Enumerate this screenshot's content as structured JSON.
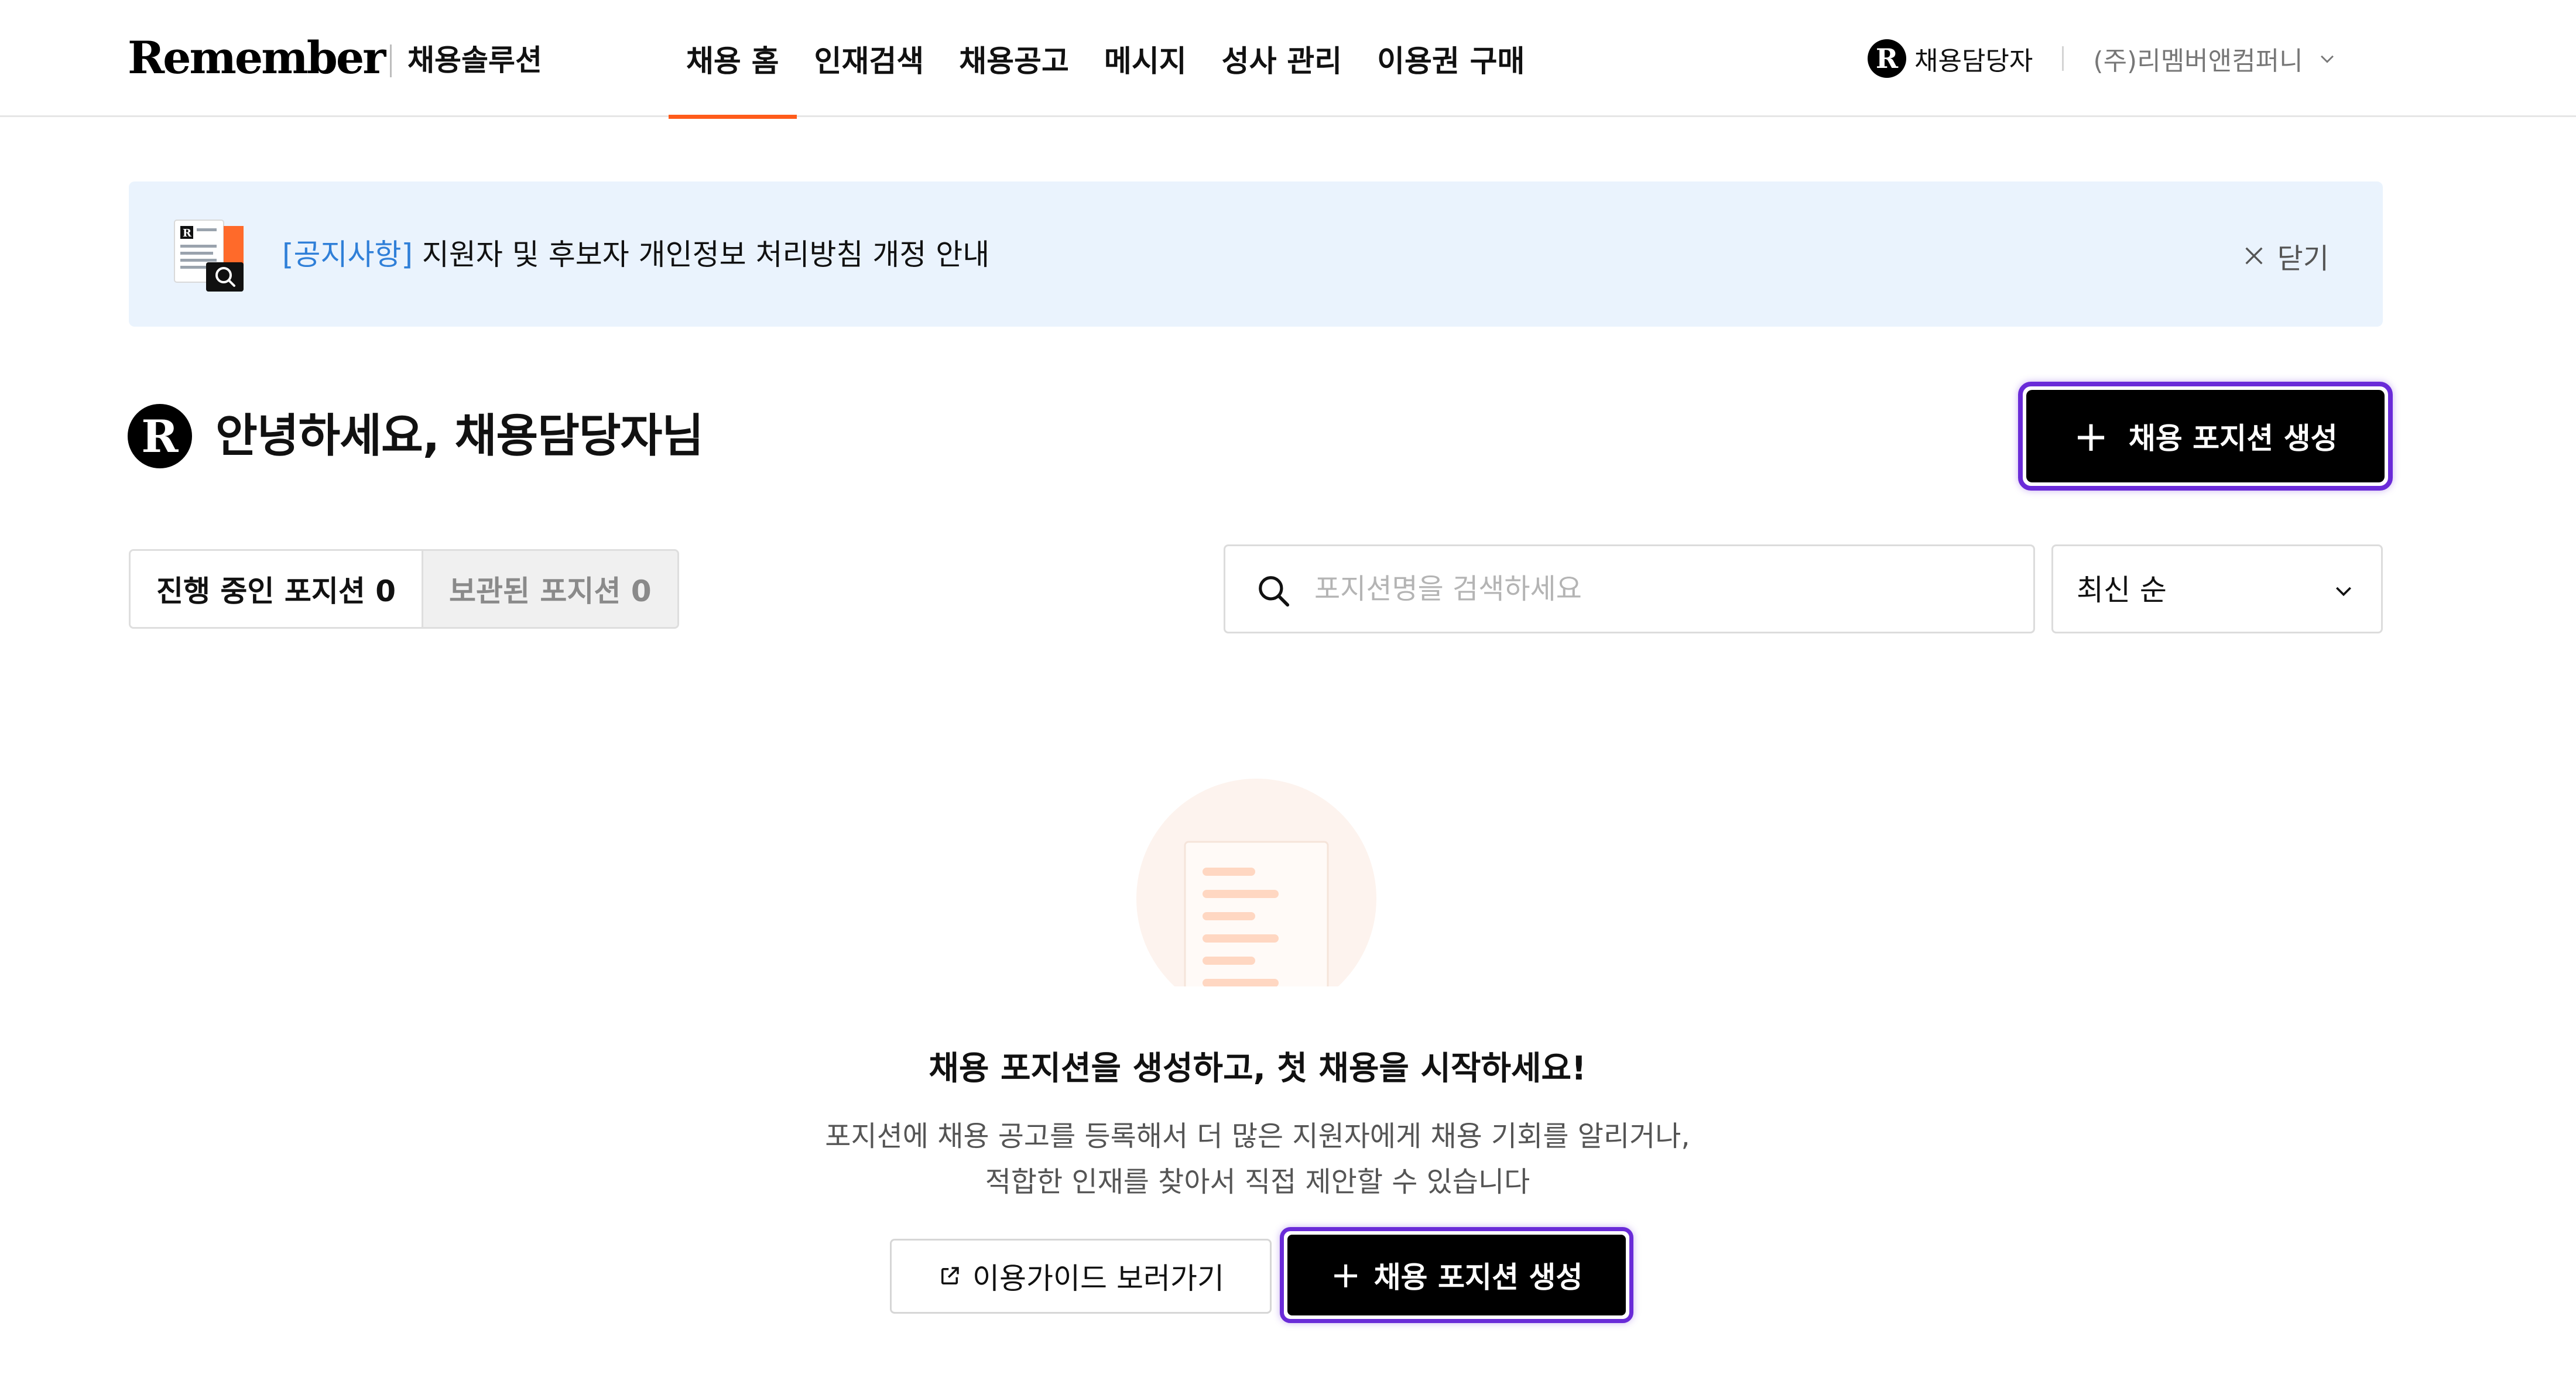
{
  "header": {
    "logo": "Remember",
    "logo_sub": "채용솔루션",
    "nav": [
      {
        "label": "채용 홈",
        "active": true
      },
      {
        "label": "인재검색",
        "active": false
      },
      {
        "label": "채용공고",
        "active": false
      },
      {
        "label": "메시지",
        "active": false
      },
      {
        "label": "성사 관리",
        "active": false
      },
      {
        "label": "이용권 구매",
        "active": false
      }
    ],
    "user_badge": "R",
    "user_name": "채용담당자",
    "company": "(주)리멤버앤컴퍼니"
  },
  "notice": {
    "tag": "[공지사항]",
    "text": " 지원자 및 후보자 개인정보 처리방침 개정 안내",
    "close_label": "닫기"
  },
  "greeting": {
    "badge": "R",
    "text": "안녕하세요, 채용담당자님"
  },
  "create_button_label": "채용 포지션 생성",
  "tabs": [
    {
      "label": "진행 중인 포지션 0",
      "active": true
    },
    {
      "label": "보관된 포지션 0",
      "active": false
    }
  ],
  "search": {
    "placeholder": "포지션명을 검색하세요",
    "value": ""
  },
  "sort": {
    "selected": "최신 순"
  },
  "empty_state": {
    "title": "채용 포지션을 생성하고, 첫 채용을 시작하세요!",
    "desc_line1": "포지션에 채용 공고를 등록해서 더 많은 지원자에게 채용 기회를 알리거나,",
    "desc_line2": "적합한 인재를 찾아서 직접 제안할 수 있습니다",
    "guide_button": "이용가이드 보러가기",
    "create_button": "채용 포지션 생성"
  },
  "colors": {
    "accent": "#ff5b1a",
    "focus_ring": "#6a2bd8",
    "notice_bg": "#eaf3fd",
    "notice_tag": "#2f7fd8",
    "primary_button": "#000000"
  },
  "icons": {
    "notice": "notice-document-search-icon",
    "close": "close-icon",
    "search": "search-icon",
    "chevron": "chevron-down-icon",
    "external": "external-link-icon",
    "plus": "plus-icon",
    "empty": "empty-document-illustration"
  }
}
